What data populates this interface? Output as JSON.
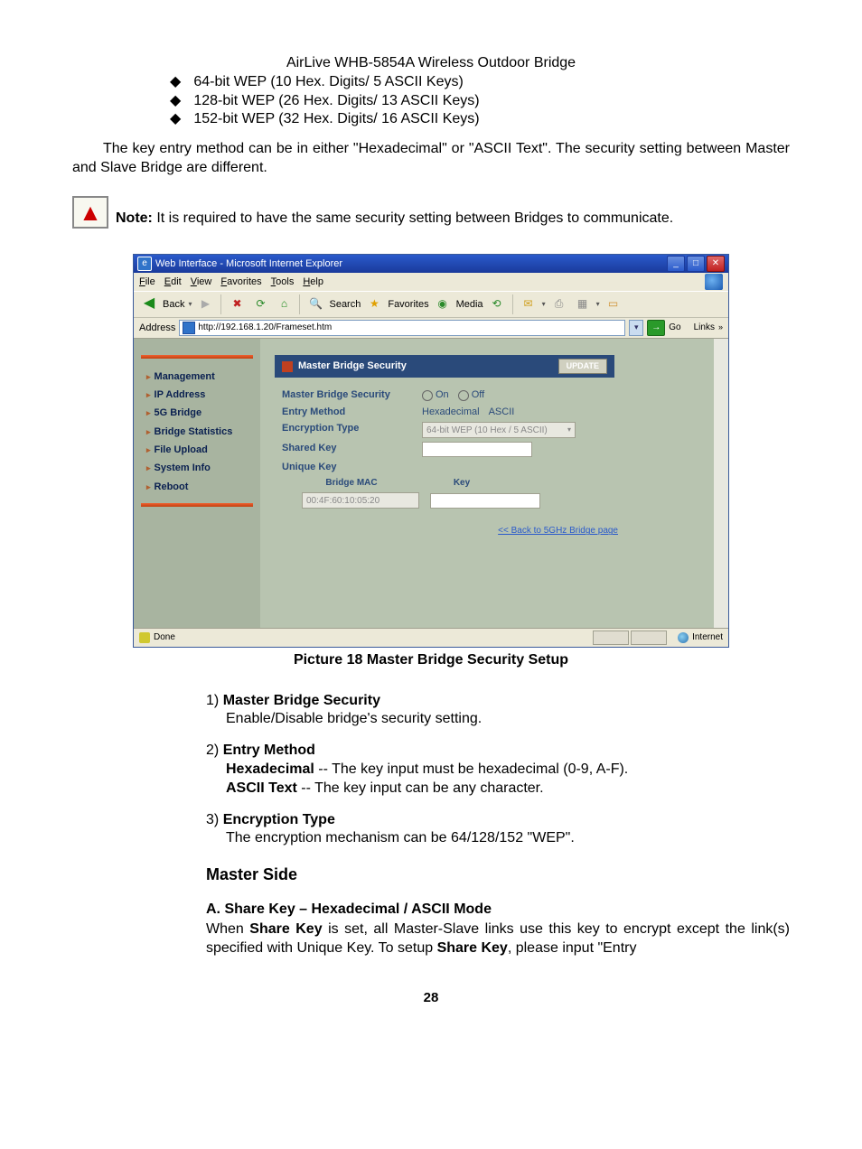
{
  "header_title": "AirLive WHB-5854A Wireless Outdoor Bridge",
  "bullets": [
    "64-bit WEP (10 Hex. Digits/ 5 ASCII Keys)",
    "128-bit WEP (26 Hex. Digits/ 13 ASCII Keys)",
    "152-bit WEP (32 Hex. Digits/ 16 ASCII Keys)"
  ],
  "para1": "The key entry method can be in either \"Hexadecimal\" or \"ASCII Text\".    The security setting between Master and Slave Bridge are different.",
  "note_label": "Note:",
  "note_text": " It is required to have the same security setting between Bridges to communicate.",
  "ie": {
    "title": "Web Interface - Microsoft Internet Explorer",
    "menus": [
      "File",
      "Edit",
      "View",
      "Favorites",
      "Tools",
      "Help"
    ],
    "back": "Back",
    "search": "Search",
    "favorites": "Favorites",
    "media": "Media",
    "addr_label": "Address",
    "url": "http://192.168.1.20/Frameset.htm",
    "go": "Go",
    "links": "Links",
    "status_done": "Done",
    "status_zone": "Internet"
  },
  "sidebar": {
    "items": [
      "Management",
      "IP Address",
      "5G Bridge",
      "Bridge Statistics",
      "File Upload",
      "System Info",
      "Reboot"
    ]
  },
  "panel": {
    "title": "Master Bridge Security",
    "update": "UPDATE",
    "rows": {
      "security_label": "Master Bridge Security",
      "on": "On",
      "off": "Off",
      "entry_label": "Entry Method",
      "hex": "Hexadecimal",
      "ascii": "ASCII",
      "enc_label": "Encryption Type",
      "enc_val": "64-bit WEP (10 Hex / 5 ASCII)",
      "shared_label": "Shared Key",
      "unique_label": "Unique Key",
      "bridge_mac": "Bridge MAC",
      "mac_val": "00:4F:60:10:05:20",
      "key_hdr": "Key"
    },
    "back_link": "<< Back to 5GHz Bridge page"
  },
  "caption": "Picture 18 Master Bridge Security Setup",
  "items": [
    {
      "num": "1)",
      "title": "Master Bridge Security",
      "desc": "Enable/Disable bridge's security setting."
    },
    {
      "num": "2)",
      "title": "Entry Method",
      "desc_lines": [
        {
          "strong": "Hexadecimal",
          "rest": " -- The key input must be hexadecimal (0-9, A-F)."
        },
        {
          "strong": "ASCII Text",
          "rest": " -- The key input can be any character."
        }
      ]
    },
    {
      "num": "3)",
      "title": "Encryption Type",
      "desc": "The encryption mechanism can be 64/128/152 \"WEP\"."
    }
  ],
  "side_heading": "Master Side",
  "sub_section": {
    "title": "A.    Share Key – Hexadecimal / ASCII Mode",
    "body_pre": "  When ",
    "body_strong1": "Share Key",
    "body_mid": " is set, all Master-Slave links use this key to encrypt except the link(s) specified with Unique Key.   To setup ",
    "body_strong2": "Share Key",
    "body_post": ", please input \"Entry"
  },
  "page_number": "28"
}
